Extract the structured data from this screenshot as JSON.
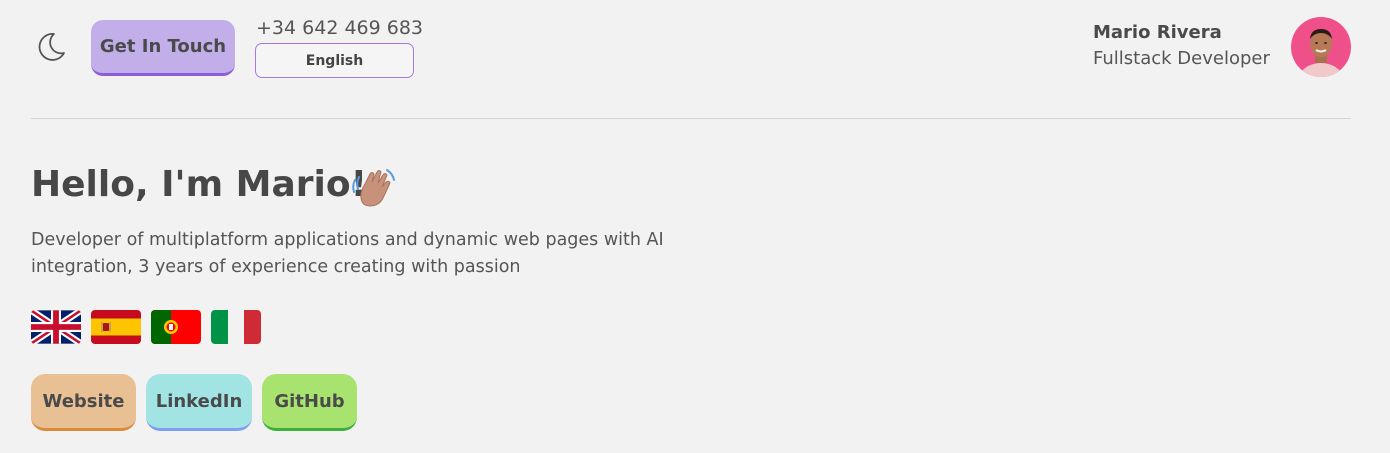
{
  "header": {
    "theme_toggle_icon": "moon-icon",
    "contact_button_label": "Get In Touch",
    "phone": "+34 642 469 683",
    "language_button_label": "English",
    "profile": {
      "name": "Mario Rivera",
      "role": "Fullstack Developer",
      "avatar_icon": "avatar"
    }
  },
  "hero": {
    "title": "Hello, I'm Mario!",
    "wave_icon": "waving-hand-icon",
    "description": "Developer of multiplatform applications and dynamic web pages with AI integration, 3 years of experience creating with passion"
  },
  "languages": [
    {
      "icon": "uk-flag-icon"
    },
    {
      "icon": "spain-flag-icon"
    },
    {
      "icon": "portugal-flag-icon"
    },
    {
      "icon": "italy-flag-icon"
    }
  ],
  "links": [
    {
      "label": "Website",
      "color": "#e9c094"
    },
    {
      "label": "LinkedIn",
      "color": "#a2e4e4"
    },
    {
      "label": "GitHub",
      "color": "#a9e36f"
    }
  ],
  "colors": {
    "background": "#f2f2f2",
    "accent": "#c2aee8",
    "accent_border": "#8a5fd6",
    "text": "#4a4a4a"
  }
}
